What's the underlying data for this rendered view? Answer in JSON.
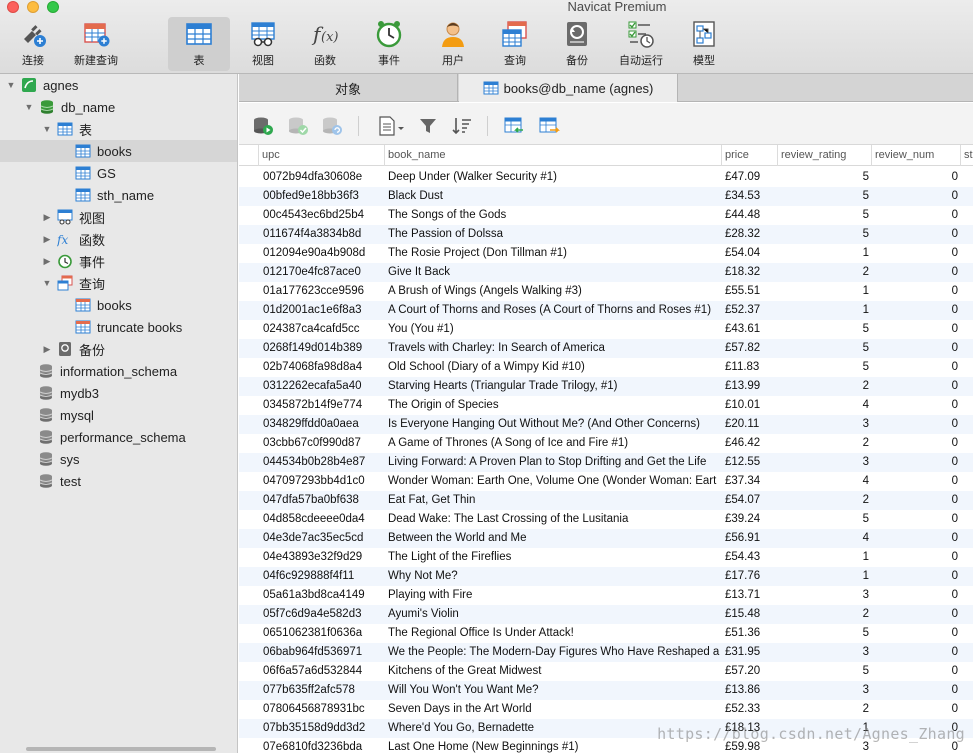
{
  "window": {
    "title": "Navicat Premium"
  },
  "toolbar": {
    "connect": "连接",
    "new_query": "新建查询",
    "table": "表",
    "view": "视图",
    "function": "函数",
    "event": "事件",
    "user": "用户",
    "query": "查询",
    "backup": "备份",
    "auto_run": "自动运行",
    "model": "模型"
  },
  "sidebar": {
    "connection": "agnes",
    "database": "db_name",
    "tables_group": "表",
    "tables": [
      "books",
      "GS",
      "sth_name"
    ],
    "views_group": "视图",
    "functions_group": "函数",
    "events_group": "事件",
    "queries_group": "查询",
    "queries": [
      "books",
      "truncate books"
    ],
    "backup_group": "备份",
    "other_databases": [
      "information_schema",
      "mydb3",
      "mysql",
      "performance_schema",
      "sys",
      "test"
    ]
  },
  "tabs": {
    "objects": "对象",
    "books": "books@db_name (agnes)"
  },
  "grid": {
    "columns": [
      "upc",
      "book_name",
      "price",
      "review_rating",
      "review_num",
      "st"
    ],
    "rows": [
      [
        "0072b94dfa30608e",
        "Deep Under (Walker Security #1)",
        "£47.09",
        "5",
        "0"
      ],
      [
        "00bfed9e18bb36f3",
        "Black Dust",
        "£34.53",
        "5",
        "0"
      ],
      [
        "00c4543ec6bd25b4",
        "The Songs of the Gods",
        "£44.48",
        "5",
        "0"
      ],
      [
        "011674f4a3834b8d",
        "The Passion of Dolssa",
        "£28.32",
        "5",
        "0"
      ],
      [
        "012094e90a4b908d",
        "The Rosie Project (Don Tillman #1)",
        "£54.04",
        "1",
        "0"
      ],
      [
        "012170e4fc87ace0",
        "Give It Back",
        "£18.32",
        "2",
        "0"
      ],
      [
        "01a177623cce9596",
        "A Brush of Wings (Angels Walking #3)",
        "£55.51",
        "1",
        "0"
      ],
      [
        "01d2001ac1e6f8a3",
        "A Court of Thorns and Roses (A Court of Thorns and Roses #1)",
        "£52.37",
        "1",
        "0"
      ],
      [
        "024387ca4cafd5cc",
        "You (You #1)",
        "£43.61",
        "5",
        "0"
      ],
      [
        "0268f149d014b389",
        "Travels with Charley: In Search of America",
        "£57.82",
        "5",
        "0"
      ],
      [
        "02b74068fa98d8a4",
        "Old School (Diary of a Wimpy Kid #10)",
        "£11.83",
        "5",
        "0"
      ],
      [
        "0312262ecafa5a40",
        "Starving Hearts (Triangular Trade Trilogy, #1)",
        "£13.99",
        "2",
        "0"
      ],
      [
        "0345872b14f9e774",
        "The Origin of Species",
        "£10.01",
        "4",
        "0"
      ],
      [
        "034829ffdd0a0aea",
        "Is Everyone Hanging Out Without Me? (And Other Concerns)",
        "£20.11",
        "3",
        "0"
      ],
      [
        "03cbb67c0f990d87",
        "A Game of Thrones (A Song of Ice and Fire #1)",
        "£46.42",
        "2",
        "0"
      ],
      [
        "044534b0b28b4e87",
        "Living Forward: A Proven Plan to Stop Drifting and Get the Life",
        "£12.55",
        "3",
        "0"
      ],
      [
        "047097293bb4d1c0",
        "Wonder Woman: Earth One, Volume One (Wonder Woman: Eart",
        "£37.34",
        "4",
        "0"
      ],
      [
        "047dfa57ba0bf638",
        "Eat Fat, Get Thin",
        "£54.07",
        "2",
        "0"
      ],
      [
        "04d858cdeeee0da4",
        "Dead Wake: The Last Crossing of the Lusitania",
        "£39.24",
        "5",
        "0"
      ],
      [
        "04e3de7ac35ec5cd",
        "Between the World and Me",
        "£56.91",
        "4",
        "0"
      ],
      [
        "04e43893e32f9d29",
        "The Light of the Fireflies",
        "£54.43",
        "1",
        "0"
      ],
      [
        "04f6c929888f4f11",
        "Why Not Me?",
        "£17.76",
        "1",
        "0"
      ],
      [
        "05a61a3bd8ca4149",
        "Playing with Fire",
        "£13.71",
        "3",
        "0"
      ],
      [
        "05f7c6d9a4e582d3",
        "Ayumi's Violin",
        "£15.48",
        "2",
        "0"
      ],
      [
        "0651062381f0636a",
        "The Regional Office Is Under Attack!",
        "£51.36",
        "5",
        "0"
      ],
      [
        "06bab964fd536971",
        "We the People: The Modern-Day Figures Who Have Reshaped a",
        "£31.95",
        "3",
        "0"
      ],
      [
        "06f6a57a6d532844",
        "Kitchens of the Great Midwest",
        "£57.20",
        "5",
        "0"
      ],
      [
        "077b635ff2afc578",
        "Will You Won't You Want Me?",
        "£13.86",
        "3",
        "0"
      ],
      [
        "07806456878931bc",
        "Seven Days in the Art World",
        "£52.33",
        "2",
        "0"
      ],
      [
        "07bb35158d9dd3d2",
        "Where'd You Go, Bernadette",
        "£18.13",
        "1",
        "0"
      ],
      [
        "07e6810fd3236bda",
        "Last One Home (New Beginnings #1)",
        "£59.98",
        "3",
        "0"
      ]
    ]
  },
  "watermark": "https://blog.csdn.net/Agnes_Zhang",
  "colors": {
    "accent_blue": "#2d7fd3",
    "db_green": "#3a9a3a",
    "selected_row": "#d6d6d6",
    "alt_row": "#f1f6fd"
  }
}
